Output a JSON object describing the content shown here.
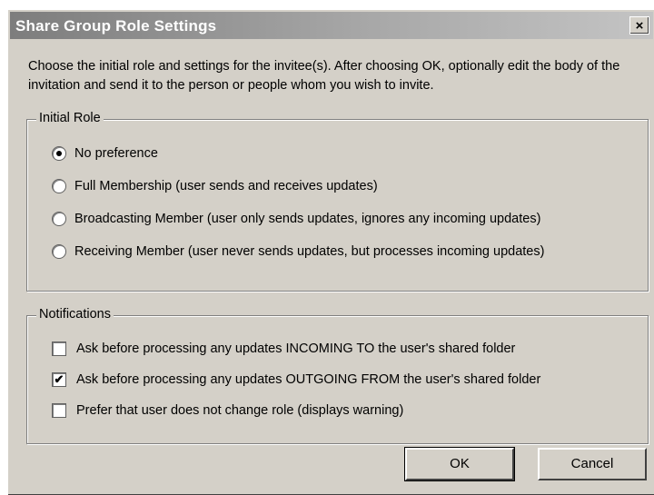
{
  "window": {
    "title": "Share Group Role Settings",
    "close_label": "×"
  },
  "intro_text": "Choose the initial role and settings for the invitee(s). After choosing OK, optionally edit the body of the invitation and send it to the person or people whom you wish to invite.",
  "initial_role": {
    "label": "Initial Role",
    "options": [
      {
        "label": "No preference",
        "selected": true
      },
      {
        "label": "Full Membership (user sends and receives updates)",
        "selected": false
      },
      {
        "label": "Broadcasting Member (user only sends updates, ignores any incoming updates)",
        "selected": false
      },
      {
        "label": "Receiving Member (user never sends updates, but processes incoming updates)",
        "selected": false
      }
    ]
  },
  "notifications": {
    "label": "Notifications",
    "options": [
      {
        "label": "Ask before processing any updates INCOMING TO the user's shared folder",
        "checked": false
      },
      {
        "label": "Ask before processing any updates OUTGOING FROM the user's shared folder",
        "checked": true
      },
      {
        "label": "Prefer that user does not change role (displays warning)",
        "checked": false
      }
    ]
  },
  "buttons": {
    "ok": "OK",
    "cancel": "Cancel"
  }
}
